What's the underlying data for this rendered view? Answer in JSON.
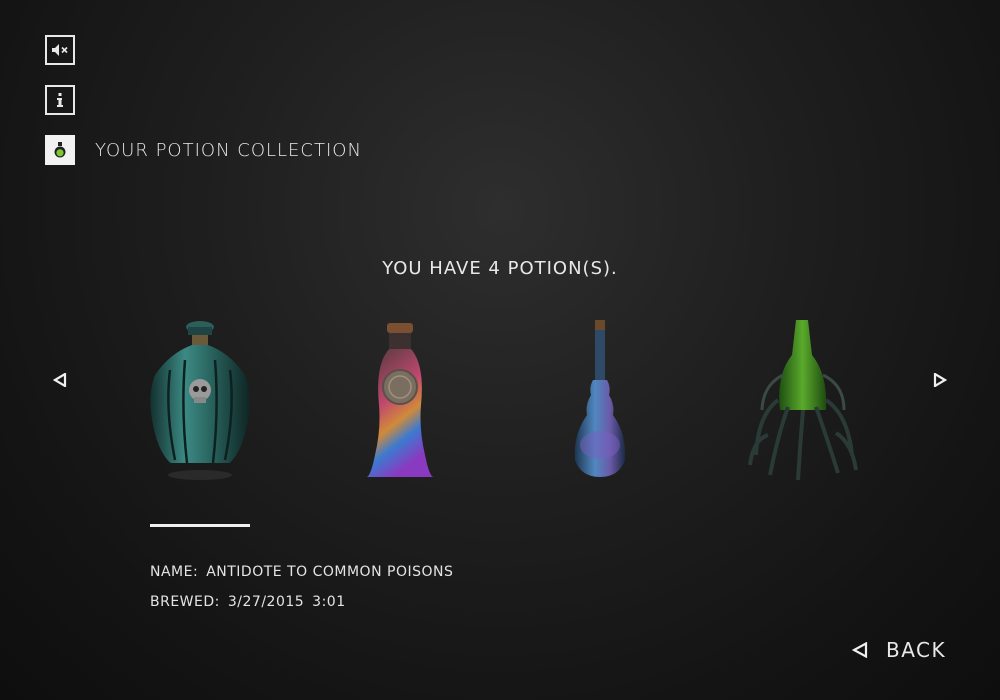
{
  "icons": {
    "mute": "mute-speaker-icon",
    "info": "info-icon",
    "collection": "potion-flask-icon",
    "left_arrow": "triangle-left-icon",
    "right_arrow": "triangle-right-icon",
    "back_arrow": "triangle-left-icon"
  },
  "header": {
    "collection_title": "YOUR POTION COLLECTION"
  },
  "main": {
    "count_text": "YOU HAVE 4 POTION(S).",
    "potions": [
      {
        "kind": "skull-bottle",
        "color": "#2f6e6a"
      },
      {
        "kind": "rainbow-vial",
        "color": "#c04a7a"
      },
      {
        "kind": "blue-flask",
        "color": "#3a6fa0"
      },
      {
        "kind": "green-root-bottle",
        "color": "#3f8a2a"
      }
    ],
    "selected_index": 0,
    "details": {
      "name_label": "NAME:",
      "name_value": "ANTIDOTE TO COMMON POISONS",
      "brewed_label": "BREWED:",
      "brewed_date": "3/27/2015",
      "brewed_time": "3:01"
    }
  },
  "footer": {
    "back_label": "BACK"
  },
  "colors": {
    "text": "#e8e8e8",
    "accent_green": "#7cc832"
  }
}
